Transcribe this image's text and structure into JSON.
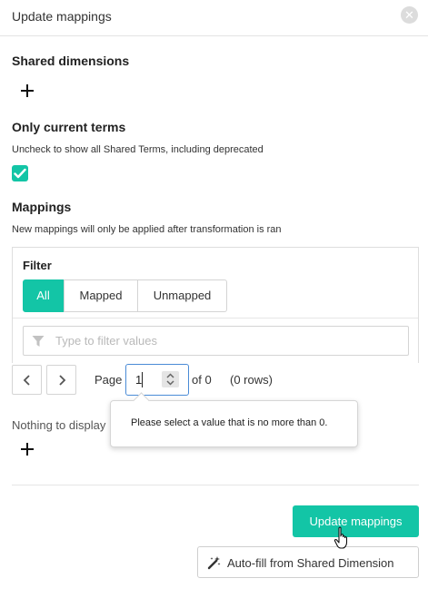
{
  "header": {
    "title": "Update mappings",
    "close_icon": "close-icon"
  },
  "shared_dimensions": {
    "title": "Shared dimensions",
    "add_icon": "plus-icon"
  },
  "only_current": {
    "title": "Only current terms",
    "hint": "Uncheck to show all Shared Terms, including deprecated",
    "checked": true
  },
  "mappings": {
    "title": "Mappings",
    "hint": "New mappings will only be applied after transformation is ran",
    "filter": {
      "label": "Filter",
      "options": [
        "All",
        "Mapped",
        "Unmapped"
      ],
      "selected": "All",
      "search_placeholder": "Type to filter values",
      "search_value": ""
    },
    "pagination": {
      "page_label": "Page",
      "page_value": "1",
      "of_label": "of 0",
      "rows_label": "(0 rows)"
    },
    "empty_text": "Nothing to display",
    "validation_message": "Please select a value that is no more than 0."
  },
  "actions": {
    "update_label": "Update mappings",
    "autofill_label": "Auto-fill from Shared Dimension"
  },
  "colors": {
    "accent": "#13c5a6",
    "focus_border": "#4a8bd6"
  }
}
